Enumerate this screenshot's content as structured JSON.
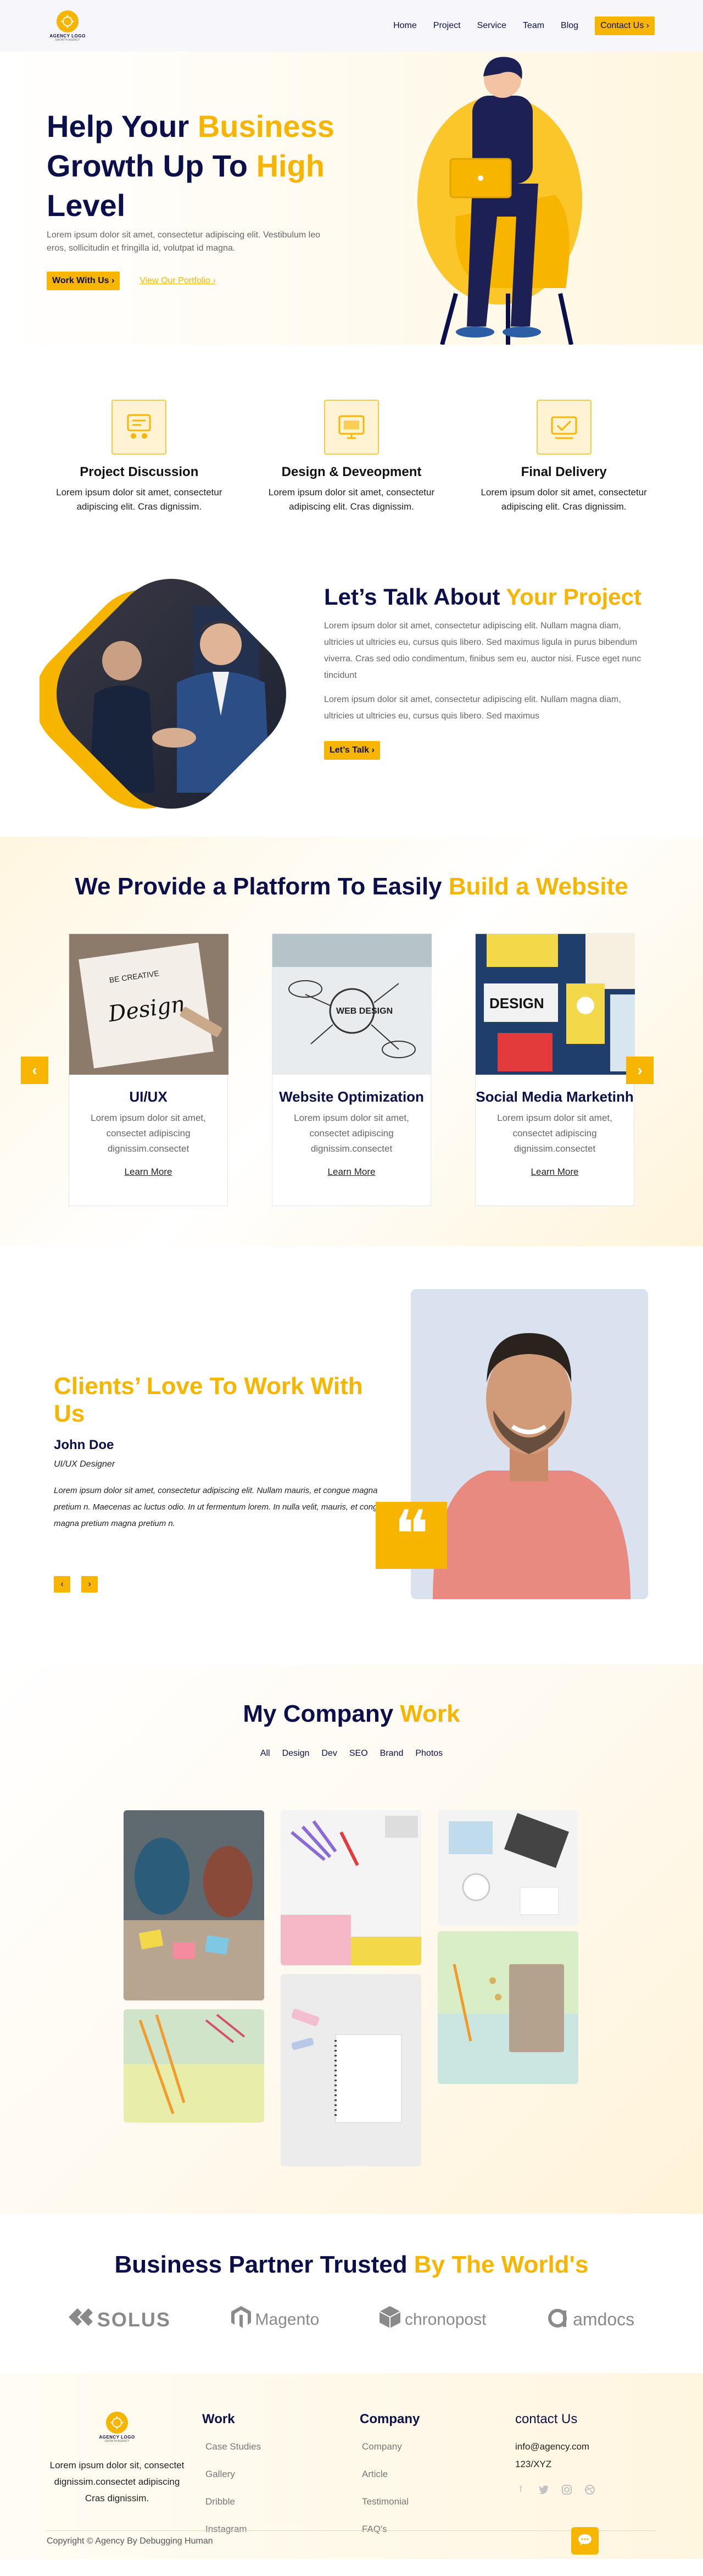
{
  "nav": {
    "logo_text": "AGENCY LOGO",
    "logo_sub": "GROWTH AGENCY",
    "menu": [
      "Home",
      "Project",
      "Service",
      "Team",
      "Blog"
    ],
    "contact_label": "Contact Us",
    "contact_icon": "chevron-right-icon"
  },
  "hero": {
    "title_part1": "Help Your ",
    "title_accent1": "Business",
    "title_part2": "Growth Up To ",
    "title_accent2": "High",
    "title_part3": "Level",
    "description": "Lorem ipsum dolor sit amet, consectetur adipiscing elit. Vestibulum leo eros, sollicitudin et fringilla id, volutpat id magna.",
    "primary_btn": "Work With Us",
    "secondary_btn": "View Our Portfolio"
  },
  "features": [
    {
      "icon": "discussion-icon",
      "title": "Project Discussion",
      "text": "Lorem ipsum dolor sit amet, consectetur adipiscing elit. Cras dignissim."
    },
    {
      "icon": "design-icon",
      "title": "Design & Deveopment",
      "text": "Lorem ipsum dolor sit amet, consectetur adipiscing elit. Cras dignissim."
    },
    {
      "icon": "delivery-icon",
      "title": "Final Delivery",
      "text": "Lorem ipsum dolor sit amet, consectetur adipiscing elit. Cras dignissim."
    }
  ],
  "talk": {
    "title_part": "Let’s Talk About ",
    "title_accent": "Your Project",
    "para1": "Lorem ipsum dolor sit amet, consectetur adipiscing elit. Nullam magna diam, ultricies ut ultricies eu, cursus quis libero. Sed maximus ligula in purus bibendum viverra. Cras sed odio condimentum, finibus sem eu, auctor nisi. Fusce eget nunc tincidunt",
    "para2": "Lorem ipsum dolor sit amet, consectetur adipiscing elit. Nullam magna diam, ultricies ut ultricies eu, cursus quis libero. Sed maximus",
    "button": "Let’s Talk"
  },
  "platform": {
    "title_part": "We Provide a Platform To Easily ",
    "title_accent": "Build a Website",
    "cards": [
      {
        "title": "UI/UX",
        "text": "Lorem ipsum dolor sit amet, consectet adipiscing dignissim.consectet",
        "link": "Learn More",
        "image_text": "BE CREATIVE Design"
      },
      {
        "title": "Website Optimization",
        "text": "Lorem ipsum dolor sit amet, consectet adipiscing dignissim.consectet",
        "link": "Learn More",
        "image_text": "WEB DESIGN"
      },
      {
        "title": "Social Media Marketinh",
        "text": "Lorem ipsum dolor sit amet, consectet adipiscing dignissim.consectet",
        "link": "Learn More",
        "image_text": "DESIGN"
      }
    ]
  },
  "testimonial": {
    "title": "Clients’ Love To Work With Us",
    "name": "John Doe",
    "role": "UI/UX Designer",
    "quote": "Lorem ipsum dolor sit amet, consectetur adipiscing elit. Nullam mauris, et congue magna pretium n. Maecenas ac luctus odio. In ut fermentum lorem. In nulla velit, mauris, et congue magna pretium magna pretium n."
  },
  "portfolio": {
    "title_part": "My Company ",
    "title_accent": "Work",
    "filters": [
      "All",
      "Design",
      "Dev",
      "SEO",
      "Brand",
      "Photos"
    ]
  },
  "partners": {
    "title_part": "Business Partner Trusted ",
    "title_accent": "By The World's",
    "logos": [
      "SOLUS",
      "Magento",
      "chronopost",
      "amdocs"
    ]
  },
  "footer": {
    "about": "Lorem ipsum dolor sit, consectet dignissim.consectet adipiscing Cras dignissim.",
    "work_title": "Work",
    "work_items": [
      "Case Studies",
      "Gallery",
      "Dribble",
      "Instagram"
    ],
    "company_title": "Company",
    "company_items": [
      "Company",
      "Article",
      "Testimonial",
      "FAQ's"
    ],
    "contact_title": "contact Us",
    "email": "info@agency.com",
    "address": "123/XYZ",
    "copyright": "Copyright © Agency By ",
    "copyright_link": "Debugging Human"
  },
  "colors": {
    "accent": "#f7b500",
    "navy": "#0b0f4a"
  }
}
